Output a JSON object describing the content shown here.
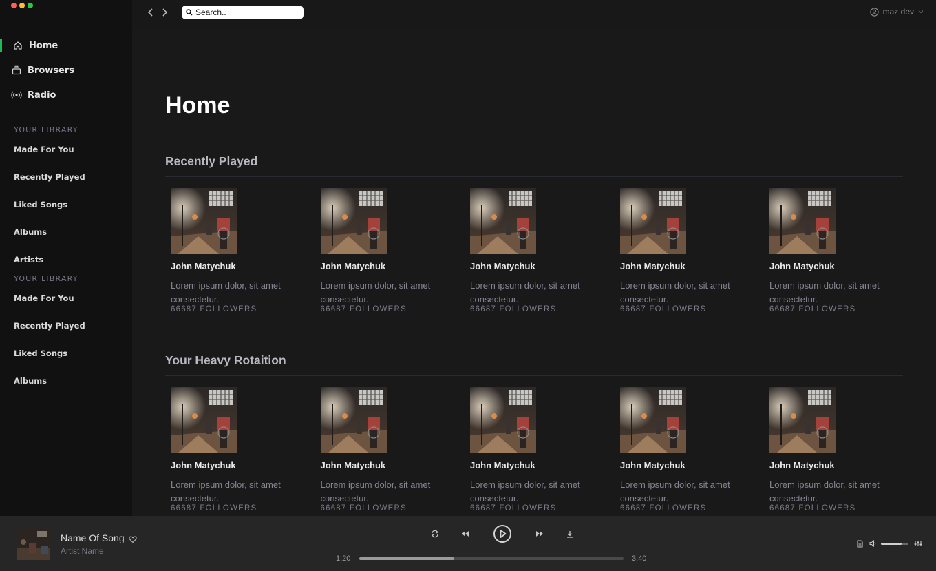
{
  "window": {
    "traffic_colors": [
      "#ff5f57",
      "#febc2e",
      "#28c840"
    ]
  },
  "colors": {
    "accent": "#1db954"
  },
  "nav": {
    "items": [
      {
        "label": "Home",
        "icon": "home-icon",
        "active": true
      },
      {
        "label": "Browsers",
        "icon": "browse-icon",
        "active": false
      },
      {
        "label": "Radio",
        "icon": "radio-icon",
        "active": false
      }
    ]
  },
  "library": {
    "heading_1": "YOUR LIBRARY",
    "items_1": [
      "Made For You",
      "Recently Played",
      "Liked Songs",
      "Albums",
      "Artists"
    ],
    "heading_2": "YOUR LIBRARY",
    "items_2": [
      "Made For You",
      "Recently Played",
      "Liked Songs",
      "Albums"
    ]
  },
  "topbar": {
    "search_placeholder": "Search..",
    "user_name": "maz dev"
  },
  "page": {
    "title": "Home"
  },
  "sections": [
    {
      "title": "Recently Played",
      "cards": [
        {
          "name": "John Matychuk",
          "desc": "Lorem ipsum dolor, sit amet consectetur.",
          "followers": "66687 FOLLOWERS"
        },
        {
          "name": "John Matychuk",
          "desc": "Lorem ipsum dolor, sit amet consectetur.",
          "followers": "66687 FOLLOWERS"
        },
        {
          "name": "John Matychuk",
          "desc": "Lorem ipsum dolor, sit amet consectetur.",
          "followers": "66687 FOLLOWERS"
        },
        {
          "name": "John Matychuk",
          "desc": "Lorem ipsum dolor, sit amet consectetur.",
          "followers": "66687 FOLLOWERS"
        },
        {
          "name": "John Matychuk",
          "desc": "Lorem ipsum dolor, sit amet consectetur.",
          "followers": "66687 FOLLOWERS"
        }
      ]
    },
    {
      "title": "Your Heavy Rotaition",
      "cards": [
        {
          "name": "John Matychuk",
          "desc": "Lorem ipsum dolor, sit amet consectetur.",
          "followers": "66687 FOLLOWERS"
        },
        {
          "name": "John Matychuk",
          "desc": "Lorem ipsum dolor, sit amet consectetur.",
          "followers": "66687 FOLLOWERS"
        },
        {
          "name": "John Matychuk",
          "desc": "Lorem ipsum dolor, sit amet consectetur.",
          "followers": "66687 FOLLOWERS"
        },
        {
          "name": "John Matychuk",
          "desc": "Lorem ipsum dolor, sit amet consectetur.",
          "followers": "66687 FOLLOWERS"
        },
        {
          "name": "John Matychuk",
          "desc": "Lorem ipsum dolor, sit amet consectetur.",
          "followers": "66687 FOLLOWERS"
        }
      ]
    }
  ],
  "player": {
    "song_title": "Name Of Song",
    "artist": "Artist Name",
    "elapsed": "1:20",
    "duration": "3:40",
    "progress": 0.36,
    "volume": 0.75
  }
}
